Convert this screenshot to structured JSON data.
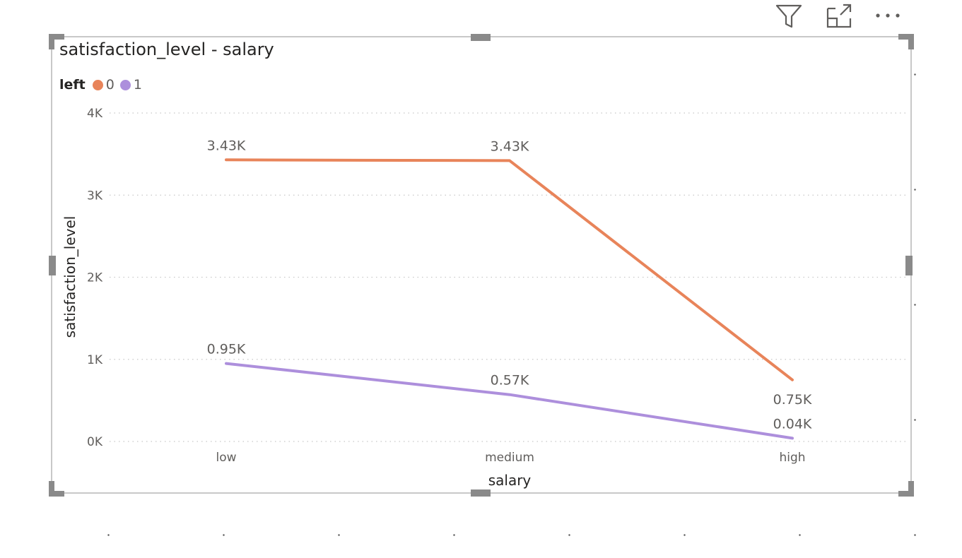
{
  "toolbar": {
    "icons": [
      "filter-icon",
      "focus-mode-icon",
      "more-options-icon"
    ]
  },
  "colors": {
    "series_0": "#e8845a",
    "series_1": "#ad8fdc",
    "axis_text": "#605e5c",
    "grid": "#c8c8c8"
  },
  "chart_data": {
    "type": "line",
    "title": "satisfaction_level - salary",
    "xlabel": "salary",
    "ylabel": "satisfaction_level",
    "categories": [
      "low",
      "medium",
      "high"
    ],
    "yticks": [
      "0K",
      "1K",
      "2K",
      "3K",
      "4K"
    ],
    "ylim": [
      0,
      4000
    ],
    "grid": true,
    "legend": {
      "title": "left",
      "placement": "top-left"
    },
    "series": [
      {
        "name": "0",
        "color": "#e8845a",
        "values": [
          3430,
          3420,
          750
        ],
        "labels": [
          "3.43K",
          "3.43K",
          "0.75K"
        ]
      },
      {
        "name": "1",
        "color": "#ad8fdc",
        "values": [
          950,
          570,
          40
        ],
        "labels": [
          "0.95K",
          "0.57K",
          "0.04K"
        ]
      }
    ]
  }
}
